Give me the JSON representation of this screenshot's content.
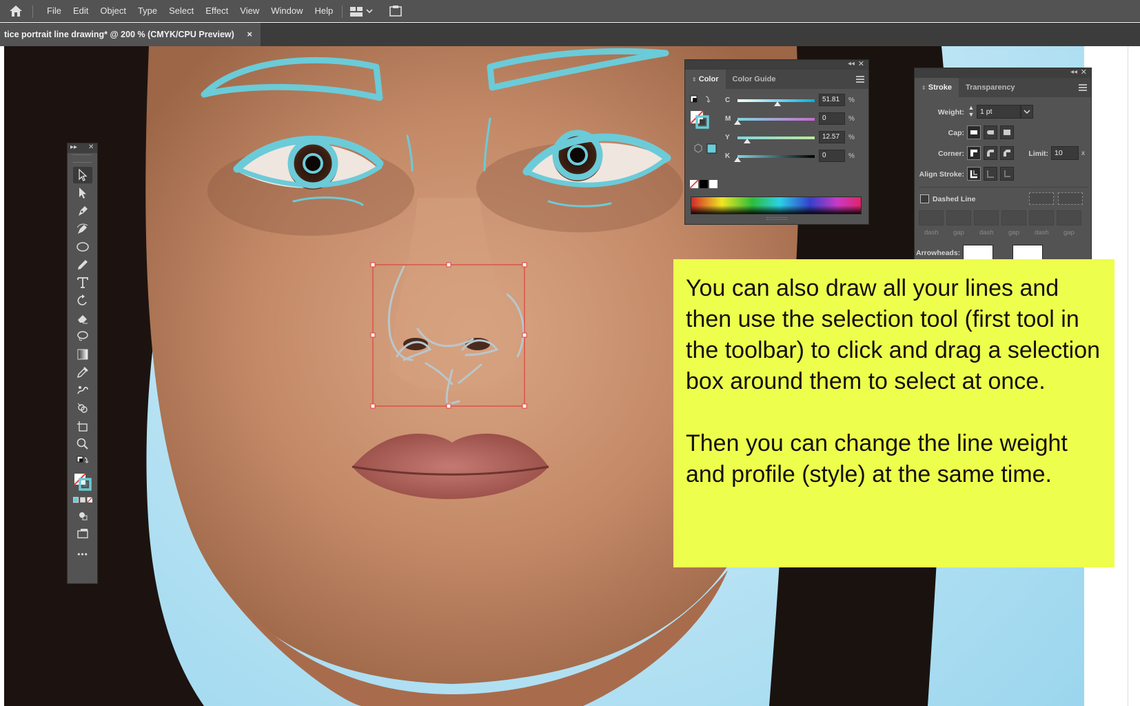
{
  "app": {
    "menu": [
      "File",
      "Edit",
      "Object",
      "Type",
      "Select",
      "Effect",
      "View",
      "Window",
      "Help"
    ]
  },
  "document_tab": {
    "title": "tice portrait line drawing* @ 200 % (CMYK/CPU Preview)",
    "close_glyph": "×"
  },
  "toolbar": {
    "tools": [
      "selection-tool",
      "direct-selection-tool",
      "pen-tool",
      "curvature-tool",
      "ellipse-tool",
      "pencil-tool",
      "type-tool",
      "rotate-tool",
      "eraser-tool",
      "lasso-tool",
      "gradient-tool",
      "eyedropper-tool",
      "puppet-warp-tool",
      "shape-builder-tool",
      "artboard-tool",
      "zoom-tool"
    ],
    "more_label": "•••"
  },
  "color_panel": {
    "tabs": [
      "Color",
      "Color Guide"
    ],
    "active_tab": "Color",
    "sliders": [
      {
        "label": "C",
        "value": "51.81",
        "unit": "%",
        "fraction": 0.5181,
        "gradient": [
          "#ffffff",
          "#00b0e0"
        ]
      },
      {
        "label": "M",
        "value": "0",
        "unit": "%",
        "fraction": 0.0,
        "gradient": [
          "#7fd6e0",
          "#c86bd0"
        ]
      },
      {
        "label": "Y",
        "value": "12.57",
        "unit": "%",
        "fraction": 0.1257,
        "gradient": [
          "#7fd6e0",
          "#bde89a"
        ]
      },
      {
        "label": "K",
        "value": "0",
        "unit": "%",
        "fraction": 0.0,
        "gradient": [
          "#80d6e3",
          "#000000"
        ]
      }
    ],
    "stroke_color": "#6bcbd8"
  },
  "stroke_panel": {
    "tabs": [
      "Stroke",
      "Transparency"
    ],
    "active_tab": "Stroke",
    "weight_label": "Weight:",
    "weight_value": "1 pt",
    "cap_label": "Cap:",
    "corner_label": "Corner:",
    "limit_label": "Limit:",
    "limit_value": "10",
    "limit_unit": "x",
    "align_label": "Align Stroke:",
    "dashed_label": "Dashed Line",
    "dashed_checked": false,
    "dash_labels": [
      "dash",
      "gap",
      "dash",
      "gap",
      "dash",
      "gap"
    ],
    "arrowheads_label": "Arrowheads:"
  },
  "callout": {
    "para1": "You can also draw all your lines and then use the selection tool (first tool in the toolbar) to click and drag a selection box around them to select at once.",
    "para2": "Then you can change the line weight and profile (style) at the same time.",
    "background": "#eefe4c"
  },
  "colors": {
    "line_art": "#6bcbd8",
    "selection_box": "#e0413d"
  }
}
